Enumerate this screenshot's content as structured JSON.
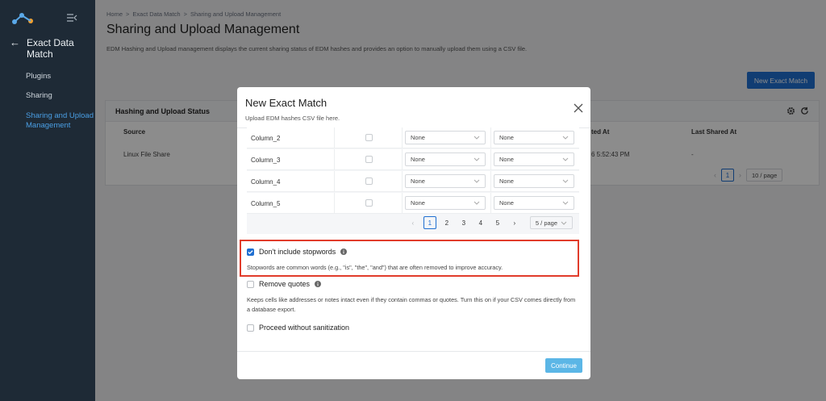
{
  "sidebar": {
    "back_title": "Exact Data Match",
    "items": [
      {
        "label": "Plugins",
        "active": false
      },
      {
        "label": "Sharing",
        "active": false
      },
      {
        "label": "Sharing and Upload Management",
        "active": true
      }
    ]
  },
  "header": {
    "breadcrumb": [
      "Home",
      ">",
      "Exact Data Match",
      ">",
      "Sharing and Upload Management"
    ],
    "title": "Sharing and Upload Management",
    "description": "EDM Hashing and Upload management displays the current sharing status of EDM hashes and provides an option to manually upload them using a CSV file."
  },
  "toolbar": {
    "new_label": "New Exact Match"
  },
  "card": {
    "title": "Hashing and Upload Status",
    "columns": {
      "source": "Source",
      "created": "ted At",
      "shared": "Last Shared At"
    },
    "rows": [
      {
        "source": "Linux File Share",
        "created": "6 5:52:43 PM",
        "shared": "-"
      }
    ],
    "pager": {
      "current": "1",
      "size": "10 / page"
    }
  },
  "modal": {
    "title": "New Exact Match",
    "subtitle": "Upload EDM hashes CSV file here.",
    "rows": [
      {
        "name": "Column_2",
        "sel1": "None",
        "sel2": "None"
      },
      {
        "name": "Column_3",
        "sel1": "None",
        "sel2": "None"
      },
      {
        "name": "Column_4",
        "sel1": "None",
        "sel2": "None"
      },
      {
        "name": "Column_5",
        "sel1": "None",
        "sel2": "None"
      }
    ],
    "pager": {
      "pages": [
        "1",
        "2",
        "3",
        "4",
        "5"
      ],
      "current": "1",
      "size": "5 / page"
    },
    "options": {
      "stopwords": {
        "label": "Don't include stopwords",
        "checked": true,
        "desc": "Stopwords are common words (e.g., \"is\", \"the\", \"and\") that are often removed to improve accuracy."
      },
      "quotes": {
        "label": "Remove quotes",
        "checked": false,
        "desc": "Keeps cells like addresses or notes intact even if they contain commas or quotes. Turn this on if your CSV comes directly from a database export."
      },
      "sanitize": {
        "label": "Proceed without sanitization",
        "checked": false
      }
    },
    "continue_label": "Continue"
  },
  "colors": {
    "accent": "#1f6fd1",
    "highlight": "#e13c2b",
    "sidebar": "#1e2a36",
    "continue": "#5bb6e6"
  }
}
